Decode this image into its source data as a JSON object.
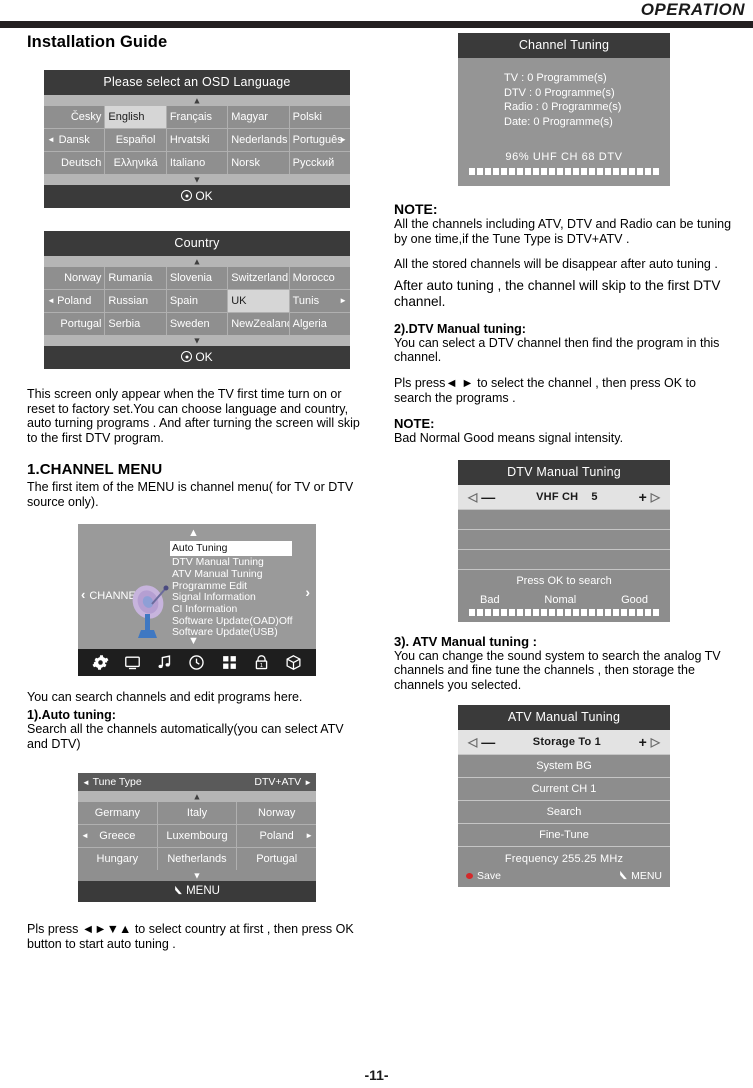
{
  "header": {
    "title": "OPERATION"
  },
  "page_number": "-11-",
  "left": {
    "installation_guide_title": "Installation Guide",
    "osd_language": {
      "title": "Please select an OSD Language",
      "up_arrow": "▲",
      "down_arrow": "▼",
      "left_arrow": "◄",
      "right_arrow": "►",
      "ok_label": "OK",
      "rows": [
        [
          "Česky",
          "English",
          "Français",
          "Magyar",
          "Polski"
        ],
        [
          "Dansk",
          "Español",
          "Hrvatski",
          "Nederlands",
          "Português"
        ],
        [
          "Deutsch",
          "Eλληνιká",
          "Italiano",
          "Norsk",
          "Pуcckий"
        ]
      ],
      "selected": "English"
    },
    "country": {
      "title": "Country",
      "up_arrow": "▲",
      "down_arrow": "▼",
      "left_arrow": "◄",
      "right_arrow": "►",
      "ok_label": "OK",
      "rows": [
        [
          "Norway",
          "Rumania",
          "Slovenia",
          "Switzerland",
          "Morocco"
        ],
        [
          "Poland",
          "Russian",
          "Spain",
          "UK",
          "Tunis"
        ],
        [
          "Portugal",
          "Serbia",
          "Sweden",
          "NewZealand",
          "Algeria"
        ]
      ],
      "selected": "UK"
    },
    "intro_paragraph": "This screen only appear when the TV first time turn on or reset to factory set.You can choose language and country, auto turning programs . And after turning the screen will  skip to the first DTV program.",
    "channel_menu_heading": "1.CHANNEL MENU",
    "channel_menu_intro": "The first item of the MENU is channel menu( for TV or DTV source only).",
    "channel_menu_osd": {
      "left_label": "CHANNEL",
      "left_chevron": "‹",
      "right_chevron": "›",
      "up_arrow": "▲",
      "down_arrow": "▼",
      "items": [
        "Auto Tuning",
        "DTV Manual Tuning",
        "ATV Manual Tuning",
        "Programme Edit",
        "Signal Information",
        "CI Information",
        "Software Update(OAD)Off",
        "Software Update(USB)"
      ],
      "selected": "Auto Tuning",
      "icons": [
        "gear-icon",
        "monitor-icon",
        "music-note-icon",
        "clock-icon",
        "grid-icon",
        "lock-icon",
        "cube-icon"
      ]
    },
    "search_note": "You can search  channels and edit programs  here.",
    "auto_tuning_heading": "1).Auto tuning:",
    "auto_tuning_text": "Search all the channels automatically(you can select ATV and DTV)",
    "tune_type_osd": {
      "label": "Tune Type",
      "value": "DTV+ATV",
      "left_arrow": "◄",
      "right_arrow": "►",
      "up_arrow": "▲",
      "down_arrow": "▼",
      "menu_label": "MENU",
      "rows": [
        [
          "Germany",
          "Italy",
          "Norway"
        ],
        [
          "Greece",
          "Luxembourg",
          "Poland"
        ],
        [
          "Hungary",
          "Netherlands",
          "Portugal"
        ]
      ]
    },
    "closing_text": "Pls press ◄►▼▲ to select  country at first , then press OK button to start auto tuning ."
  },
  "right": {
    "channel_tuning_osd": {
      "title": "Channel Tuning",
      "lines": [
        "TV    : 0 Programme(s)",
        "DTV : 0 Programme(s)",
        "Radio : 0 Programme(s)",
        "Date:  0 Programme(s)"
      ],
      "status": "96%   UHF   CH   68 DTV",
      "progress_percent": 96,
      "progress_block_count": 24
    },
    "note1_heading": "NOTE:",
    "note1_text": "All the channels including ATV,  DTV and Radio can be tuning by one time,if the Tune Type is DTV+ATV .",
    "note1_text2": "All the stored channels will be disappear after auto tuning .",
    "note1_text3": "After auto tuning , the channel will skip to the first DTV channel.",
    "dtv_heading": "2).DTV Manual tuning:",
    "dtv_text": "You can select a DTV channel then  find the program in this channel.",
    "dtv_text2": "Pls press◄ ► to select the channel , then press OK to search the programs .",
    "note2_heading": "NOTE:",
    "note2_text": "Bad Normal Good means signal intensity.",
    "dtv_manual_osd": {
      "title": "DTV Manual Tuning",
      "stepper_label": "VHF CH",
      "stepper_value": "5",
      "minus": "—",
      "plus": "+",
      "left_tri": "◁",
      "right_tri": "▷",
      "press_ok": "Press OK to search",
      "signal_bad": "Bad",
      "signal_normal": "Nomal",
      "signal_good": "Good",
      "progress_block_count": 24
    },
    "atv_heading": "3). ATV  Manual tuning :",
    "atv_text": "You can change the sound system to search the analog TV channels and fine tune the channels , then storage the channels you selected.",
    "atv_manual_osd": {
      "title": "ATV Manual Tuning",
      "stepper_label": "Storage To 1",
      "minus": "—",
      "plus": "+",
      "left_tri": "◁",
      "right_tri": "▷",
      "rows": [
        "System BG",
        "Current CH 1",
        "Search",
        "Fine-Tune"
      ],
      "frequency": "Frequency  255.25  MHz",
      "save_label": "Save",
      "menu_label": "MENU"
    }
  },
  "colors": {
    "rule": "#231f20",
    "osd_title_bg": "#3a3a3a",
    "osd_body_bg": "#8f8f8f",
    "osd_selected_bg": "#d6d6d6",
    "save_red": "#d4282a"
  }
}
